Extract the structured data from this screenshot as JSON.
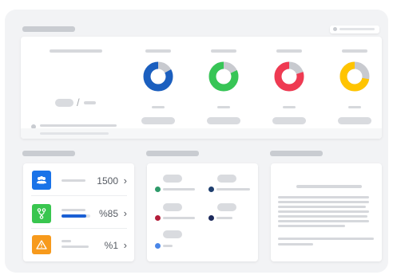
{
  "title_text": "",
  "colors": {
    "donut_blue": "#1b5fbf",
    "donut_green": "#37c556",
    "donut_red": "#ef3a52",
    "donut_yellow": "#ffc400",
    "donut_track": "#c8cacf",
    "tile_blue": "#1a73e8",
    "tile_green": "#39c64f",
    "tile_orange": "#f79a1c",
    "progress_blue": "#1a5fd4"
  },
  "donuts": [
    {
      "name": "donut-chart-blue",
      "color_key": "donut_blue",
      "fill": 0.83
    },
    {
      "name": "donut-chart-green",
      "color_key": "donut_green",
      "fill": 0.82
    },
    {
      "name": "donut-chart-red",
      "color_key": "donut_red",
      "fill": 0.8
    },
    {
      "name": "donut-chart-yellow",
      "color_key": "donut_yellow",
      "fill": 0.72
    }
  ],
  "summary": {
    "separator": "/"
  },
  "stats": [
    {
      "icon": "users-icon",
      "value": "1500",
      "chevron": "›"
    },
    {
      "icon": "branch-icon",
      "value": "%85",
      "chevron": "›",
      "progress": 0.85
    },
    {
      "icon": "warning-icon",
      "value": "%1",
      "chevron": "›"
    }
  ],
  "activity_dots": [
    {
      "color": "#2e9a6a"
    },
    {
      "color": "#1f3f6e"
    },
    {
      "color": "#b31d3a"
    },
    {
      "color": "#1d2a5c"
    },
    {
      "color": "#4a86e8"
    }
  ]
}
